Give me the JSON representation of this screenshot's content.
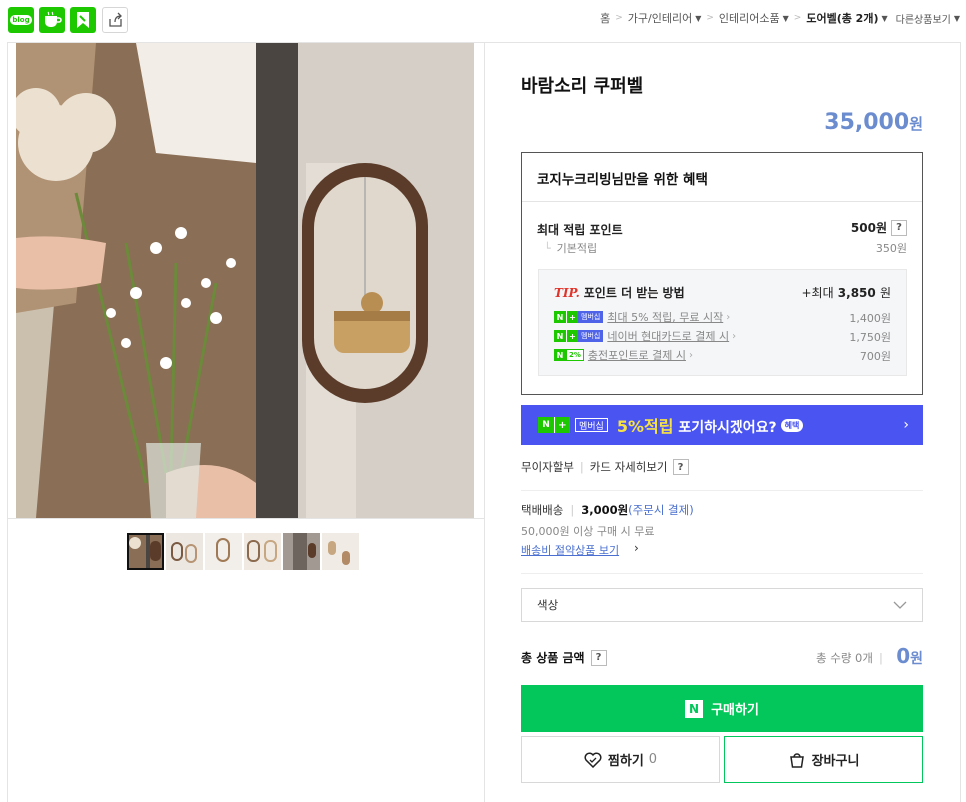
{
  "top_icons": {
    "blog_label": "blog"
  },
  "breadcrumb": {
    "home": "홈",
    "level1": "가구/인테리어",
    "level2": "인테리어소품",
    "current": "도어벨(총 2개)",
    "more": "다른상품보기"
  },
  "product": {
    "title": "바람소리 쿠퍼벨",
    "price": "35,000",
    "price_unit": "원"
  },
  "benefit": {
    "heading": "코지누크리빙님만을 위한 혜택",
    "max_points_label": "최대 적립 포인트",
    "max_points_value": "500원",
    "basic_label": "기본적립",
    "basic_value": "350원",
    "tip_prefix": "TIP.",
    "tip_heading": "포인트 더 받는 방법",
    "tip_total_prefix": "+최대",
    "tip_total": "3,850",
    "tip_total_unit": "원",
    "tips": [
      {
        "badge": "멤버십",
        "text": "최대 5% 적립, 무료 시작",
        "value": "1,400원"
      },
      {
        "badge": "멤버십",
        "text": "네이버 현대카드로 결제 시",
        "value": "1,750원"
      },
      {
        "badge": "2%",
        "text": "충전포인트로 결제 시",
        "value": "700원"
      }
    ]
  },
  "banner": {
    "badge": "멤버십",
    "highlight": "5%적립",
    "text": "포기하시겠어요?",
    "pill": "혜택"
  },
  "payment": {
    "installment": "무이자할부",
    "card_detail": "카드 자세히보기"
  },
  "shipping": {
    "method": "택배배송",
    "fee": "3,000원",
    "fee_note": "(주문시 결제)",
    "free_condition": "50,000원 이상 구매 시 무료",
    "saver_link": "배송비 절약상품 보기"
  },
  "option": {
    "placeholder": "색상"
  },
  "total": {
    "label": "총 상품 금액",
    "qty": "총 수량 0개",
    "amount": "0",
    "unit": "원"
  },
  "actions": {
    "buy": "구매하기",
    "buy_logo": "N",
    "zzim": "찜하기",
    "zzim_count": "0",
    "cart": "장바구니"
  },
  "colors": {
    "naver_green": "#03c75a",
    "price_blue": "#6b8ccf",
    "banner_blue": "#4a54f1"
  }
}
